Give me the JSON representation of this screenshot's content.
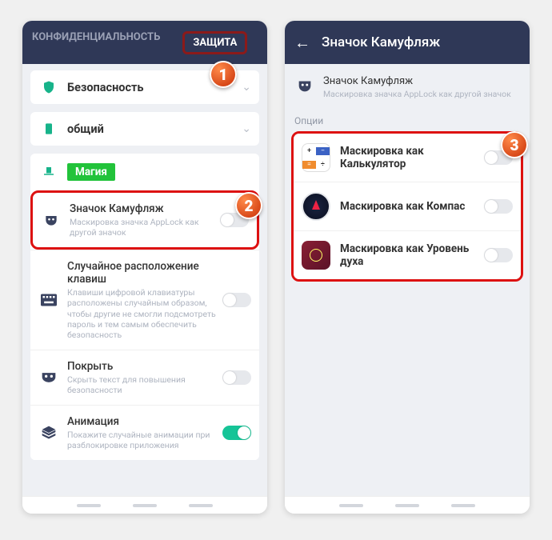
{
  "left": {
    "tabs": {
      "inactive": "КОНФИДЕНЦИАЛЬНОСТЬ",
      "active": "ЗАЩИТА"
    },
    "security": "Безопасность",
    "general": "общий",
    "magic": "Магия",
    "rows": {
      "camo": {
        "title": "Значок Камуфляж",
        "desc": "Маскировка значка AppLock как другой значок"
      },
      "random": {
        "title": "Случайное расположение клавиш",
        "desc": "Клавиши цифровой клавиатуры расположены случайным образом, чтобы другие не смогли подсмотреть пароль и тем самым обеспечить безопасность"
      },
      "cover": {
        "title": "Покрыть",
        "desc": "Скрыть текст для повышения безопасности"
      },
      "anim": {
        "title": "Анимация",
        "desc": "Покажите случайные анимации при разблокировке приложения"
      }
    }
  },
  "right": {
    "title": "Значок Камуфляж",
    "intro": {
      "title": "Значок Камуфляж",
      "desc": "Маскировка значка AppLock как другой значок"
    },
    "options_label": "Опции",
    "items": {
      "calc": "Маскировка как Калькулятор",
      "compass": "Маскировка как Компас",
      "level": "Маскировка как Уровень духа"
    }
  },
  "badges": {
    "b1": "1",
    "b2": "2",
    "b3": "3"
  }
}
